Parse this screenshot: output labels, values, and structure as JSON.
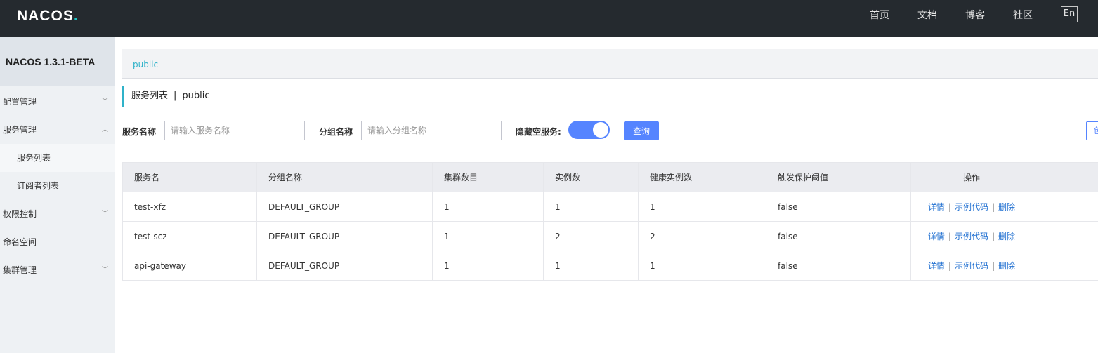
{
  "topbar": {
    "logo_text": "NACOS",
    "logo_dot": ".",
    "nav": [
      "首页",
      "文档",
      "博客",
      "社区"
    ],
    "lang": "En"
  },
  "sidebar": {
    "version": "NACOS 1.3.1-BETA",
    "items": [
      {
        "label": "配置管理",
        "chevron": "﹀"
      },
      {
        "label": "服务管理",
        "chevron": "︿"
      },
      {
        "label": "服务列表"
      },
      {
        "label": "订阅者列表"
      },
      {
        "label": "权限控制",
        "chevron": "﹀"
      },
      {
        "label": "命名空间"
      },
      {
        "label": "集群管理",
        "chevron": "﹀"
      }
    ]
  },
  "breadcrumb": {
    "namespace": "public"
  },
  "page": {
    "title": "服务列表",
    "separator": "|",
    "namespace": "public"
  },
  "filters": {
    "service_name_label": "服务名称",
    "service_name_placeholder": "请输入服务名称",
    "group_name_label": "分组名称",
    "group_name_placeholder": "请输入分组名称",
    "hide_empty_label": "隐藏空服务:",
    "hide_empty_on": true,
    "query_label": "查询",
    "create_label": "创"
  },
  "table": {
    "headers": [
      "服务名",
      "分组名称",
      "集群数目",
      "实例数",
      "健康实例数",
      "触发保护阈值",
      "操作"
    ],
    "rows": [
      [
        "test-xfz",
        "DEFAULT_GROUP",
        "1",
        "1",
        "1",
        "false"
      ],
      [
        "test-scz",
        "DEFAULT_GROUP",
        "1",
        "2",
        "2",
        "false"
      ],
      [
        "api-gateway",
        "DEFAULT_GROUP",
        "1",
        "1",
        "1",
        "false"
      ]
    ],
    "actions": {
      "detail": "详情",
      "sample": "示例代码",
      "delete": "删除",
      "sep": "|"
    }
  },
  "colors": {
    "topbar": "#252a2f",
    "accent": "#2fb2c9",
    "primary": "#5584ff",
    "link": "#1f6fd1"
  }
}
